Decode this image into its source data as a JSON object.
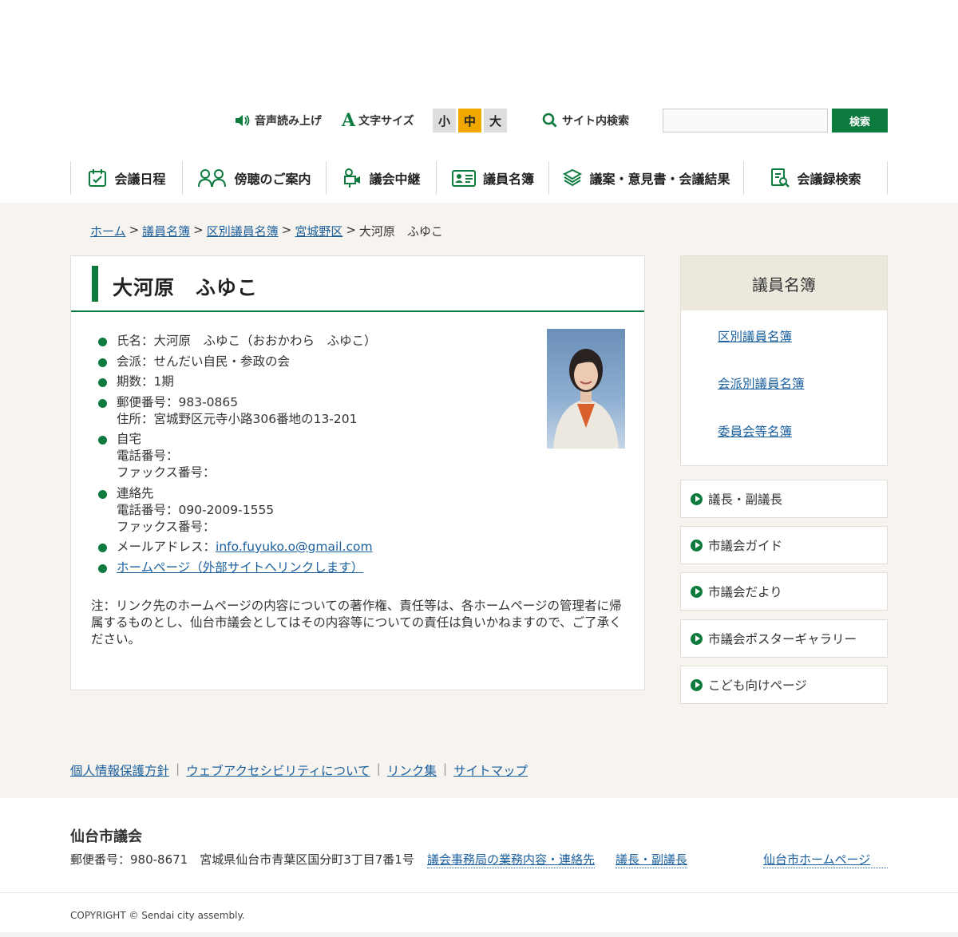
{
  "utility": {
    "voice_label": "音声読み上げ",
    "font_size_label": "文字サイズ",
    "font_sizes": [
      "小",
      "中",
      "大"
    ],
    "search_label": "サイト内検索",
    "search_value": "",
    "search_button": "検索"
  },
  "nav": [
    {
      "label": "会議日程",
      "icon": "calendar-check-icon"
    },
    {
      "label": "傍聴のご案内",
      "icon": "people-icon"
    },
    {
      "label": "議会中継",
      "icon": "video-camera-icon"
    },
    {
      "label": "議員名簿",
      "icon": "id-card-icon"
    },
    {
      "label": "議案・意見書・会議結果",
      "icon": "document-stack-icon"
    },
    {
      "label": "会議録検索",
      "icon": "document-search-icon"
    }
  ],
  "breadcrumb": {
    "items": [
      "ホーム",
      "議員名簿",
      "区別議員名簿",
      "宮城野区"
    ],
    "current": "大河原　ふゆこ",
    "sep": ">"
  },
  "profile": {
    "title": "大河原　ふゆこ",
    "name": "氏名：大河原　ふゆこ（おおかわら　ふゆこ）",
    "faction": "会派：せんだい自民・参政の会",
    "term": "期数：1期",
    "postal": "郵便番号：983-0865",
    "address": "住所：宮城野区元寺小路306番地の13-201",
    "home_label": "自宅",
    "home_phone": "電話番号：",
    "home_fax": "ファックス番号：",
    "contact_label": "連絡先",
    "contact_phone": "電話番号：090-2009-1555",
    "contact_fax": "ファックス番号：",
    "mail_label": "メールアドレス：",
    "mail": "info.fuyuko.o@gmail.com",
    "homepage": "ホームページ（外部サイトへリンクします）",
    "note": "注：リンク先のホームページの内容についての著作権、責任等は、各ホームページの管理者に帰属するものとし、仙台市議会としてはその内容等についての責任は負いかねますので、ご了承ください。"
  },
  "sidebar": {
    "heading": "議員名簿",
    "links": [
      "区別議員名簿",
      "会派別議員名簿",
      "委員会等名簿"
    ],
    "buttons": [
      "議長・副議長",
      "市議会ガイド",
      "市議会だより",
      "市議会ポスターギャラリー",
      "こども向けページ"
    ]
  },
  "footer": {
    "links": [
      "個人情報保護方針",
      "ウェブアクセシビリティについて",
      "リンク集",
      "サイトマップ"
    ],
    "link_sep": "|",
    "org": "仙台市議会",
    "address": "郵便番号：980-8671　宮城県仙台市青葉区国分町3丁目7番1号",
    "office_link": "議会事務局の業務内容・連絡先",
    "chair_link": "議長・副議長",
    "city_link": "仙台市ホームページ",
    "copyright": "COPYRIGHT © Sendai city assembly."
  },
  "colors": {
    "brand_green": "#0d7a3e",
    "band_beige": "#f7f3ee",
    "font_mid_active": "#f0a800"
  }
}
